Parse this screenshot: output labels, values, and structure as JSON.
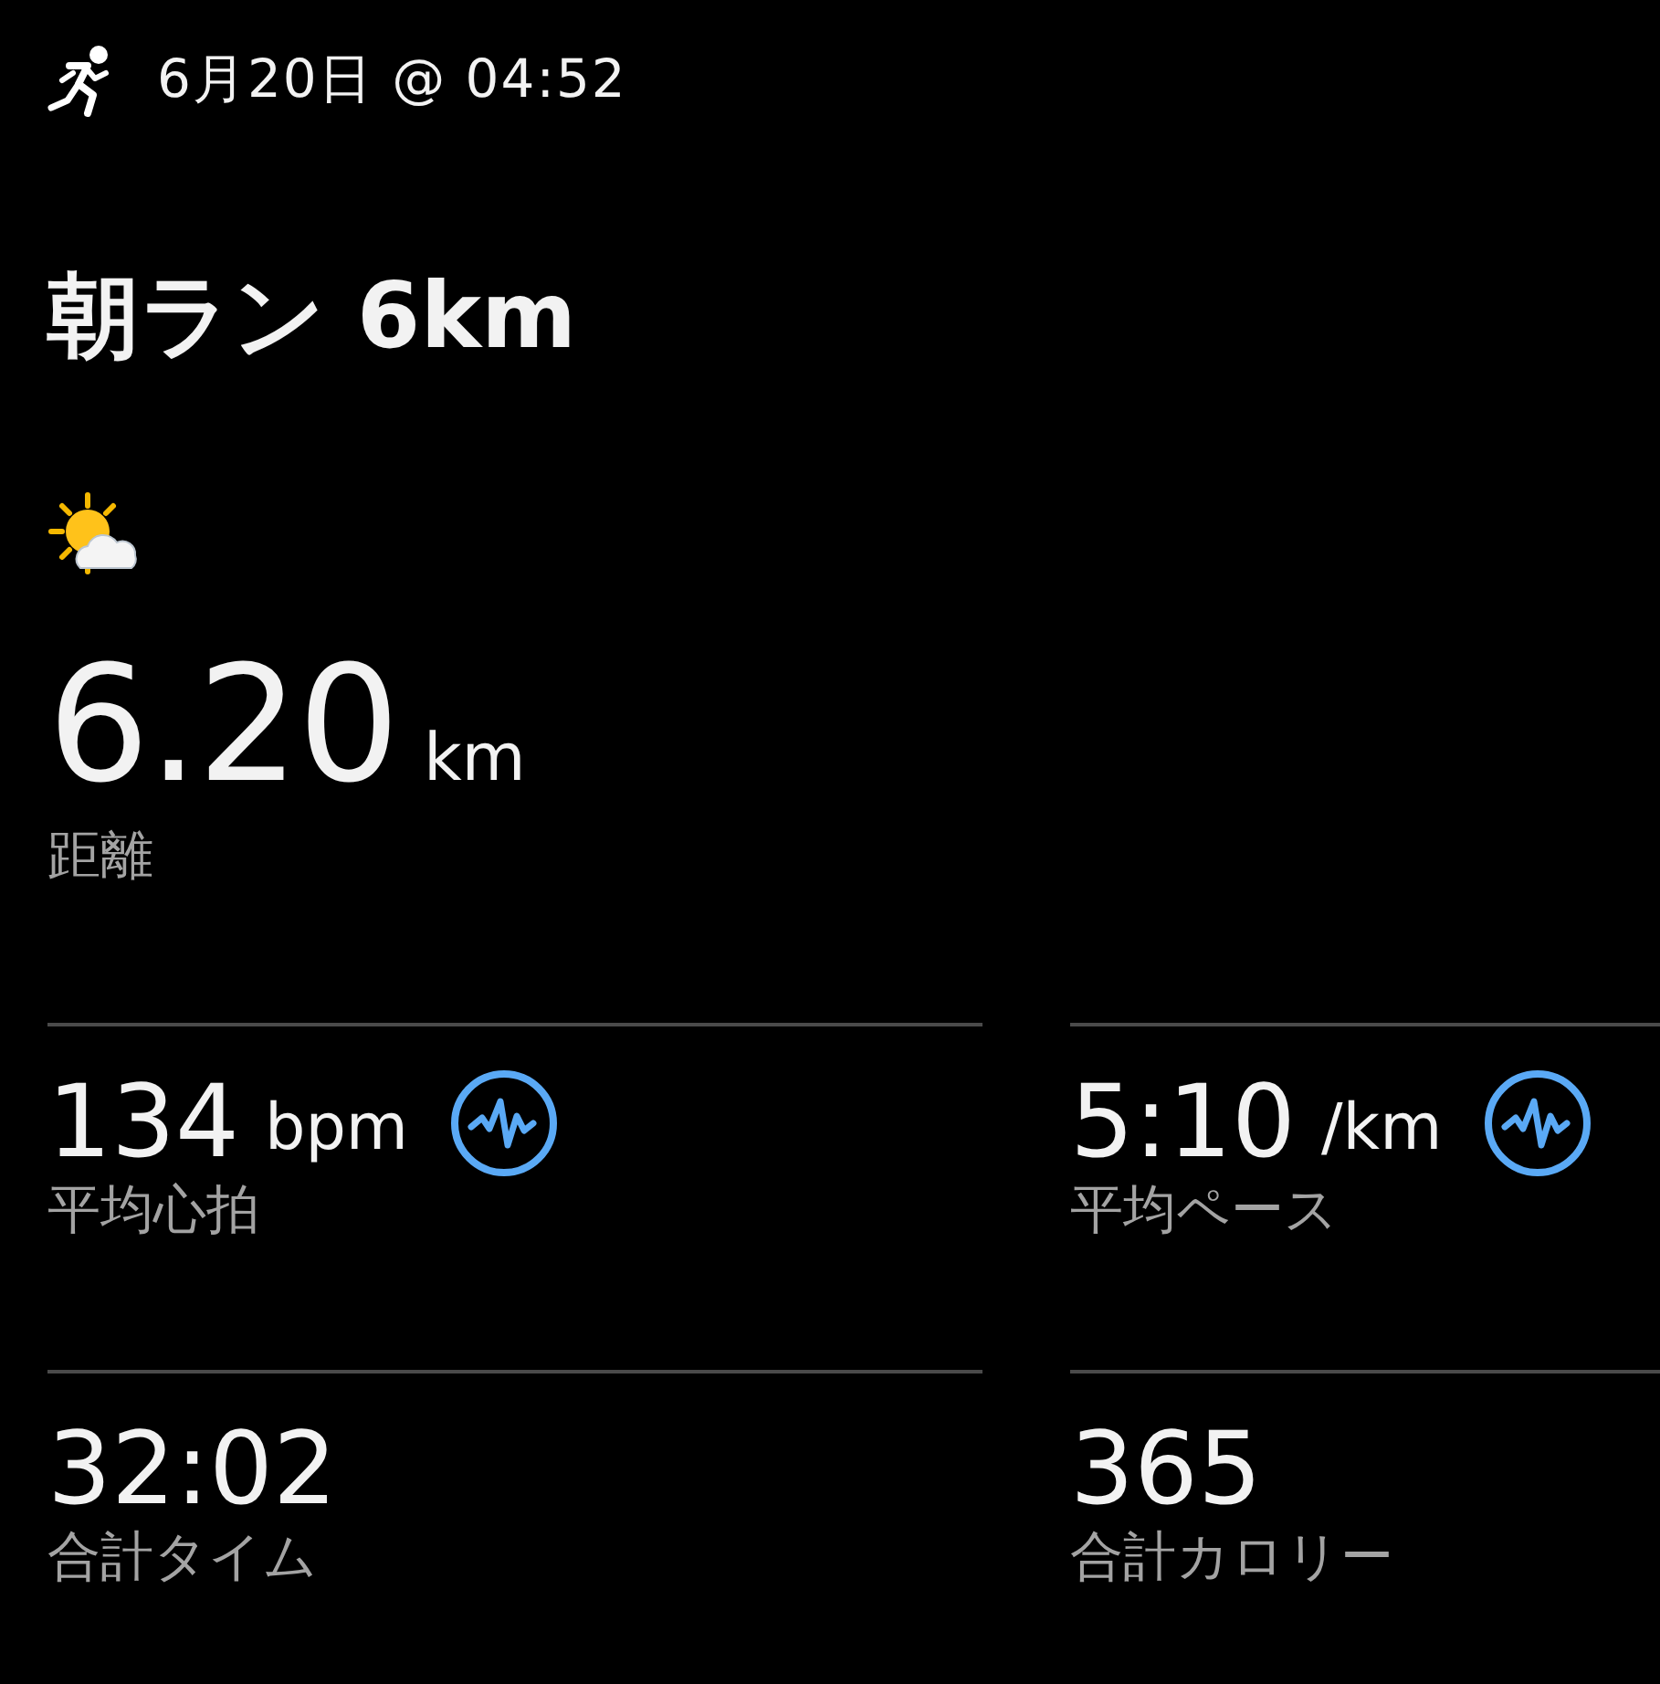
{
  "header": {
    "date": "6月20日 @ 04:52"
  },
  "title": "朝ラン 6km",
  "distance": {
    "value": "6.20",
    "unit": "km",
    "label": "距離"
  },
  "stats": [
    {
      "value": "134",
      "unit": "bpm",
      "label": "平均心拍",
      "analysis_icon": true
    },
    {
      "value": "5:10",
      "unit": "/km",
      "label": "平均ペース",
      "analysis_icon": true
    },
    {
      "value": "32:02",
      "label": "合計タイム",
      "analysis_icon": false
    },
    {
      "value": "365",
      "label": "合計カロリー",
      "analysis_icon": false
    }
  ]
}
